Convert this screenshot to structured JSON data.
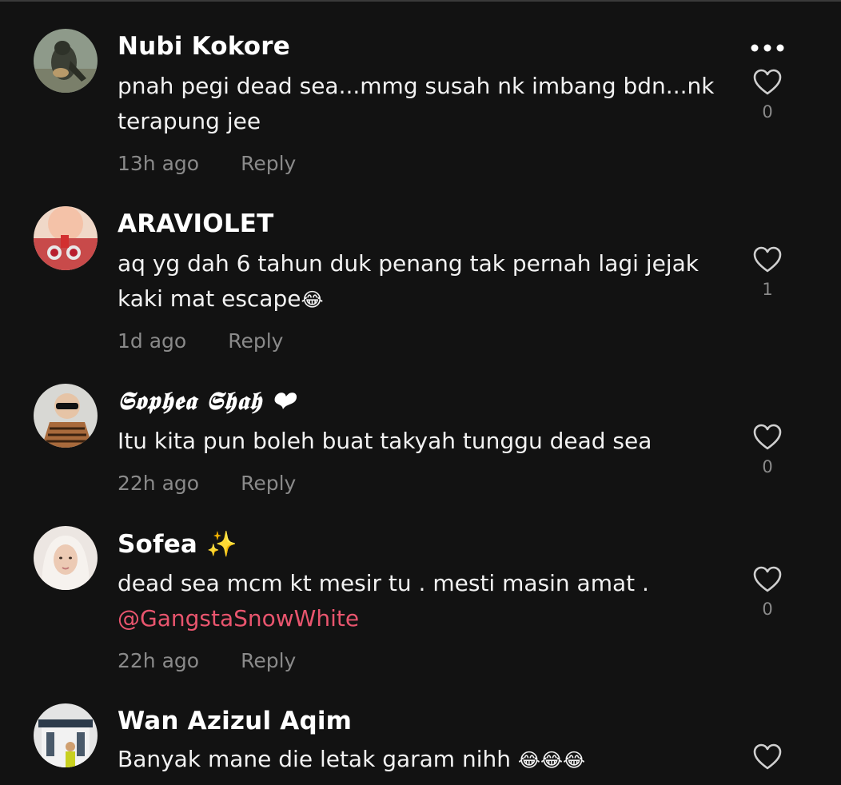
{
  "comments": [
    {
      "username": "Nubi Kokore",
      "text": "pnah pegi dead sea...mmg susah nk imbang bdn...nk terapung jee",
      "time": "13h ago",
      "reply": "Reply",
      "likes": "0"
    },
    {
      "username": "ARAVIOLET",
      "text": "aq yg dah 6 tahun duk penang tak pernah lagi jejak kaki mat escape",
      "emoji": "😂",
      "time": "1d ago",
      "reply": "Reply",
      "likes": "1"
    },
    {
      "username": "𝕾𝖔𝖕𝖍𝖊𝖆 𝕾𝖍𝖆𝖍 ❤",
      "text": "Itu kita pun boleh buat takyah tunggu dead sea",
      "time": "22h ago",
      "reply": "Reply",
      "likes": "0"
    },
    {
      "username": "Sofea ✨",
      "text": "dead sea mcm kt mesir tu . mesti masin amat .",
      "mention": "@GangstaSnowWhite",
      "time": "22h ago",
      "reply": "Reply",
      "likes": "0"
    },
    {
      "username": "Wan Azizul Aqim",
      "text": "Banyak mane die letak garam nihh",
      "emoji": "😂😂😂"
    }
  ],
  "icons": {
    "more": "more-horizontal-icon",
    "like": "heart-outline-icon"
  },
  "colors": {
    "background": "#121212",
    "mention": "#e9556e",
    "meta": "#8a8a8a"
  }
}
